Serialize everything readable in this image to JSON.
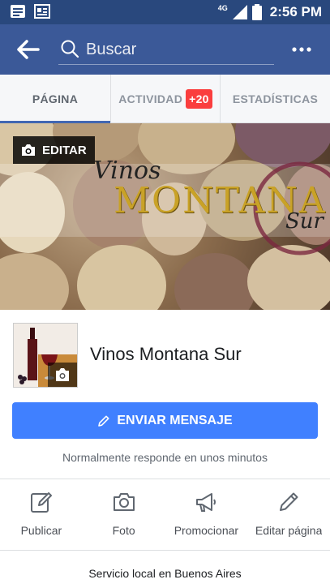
{
  "status_bar": {
    "network": "4G",
    "time": "2:56 PM"
  },
  "search": {
    "placeholder": "Buscar"
  },
  "tabs": [
    {
      "label": "PÁGINA",
      "active": true
    },
    {
      "label": "ACTIVIDAD",
      "badge": "+20"
    },
    {
      "label": "ESTADÍSTICAS"
    }
  ],
  "cover": {
    "edit_label": "EDITAR",
    "logo_line1": "Vinos",
    "logo_line2": "MONTANA",
    "logo_line3": "Sur"
  },
  "page": {
    "name": "Vinos Montana Sur",
    "send_message_label": "ENVIAR MENSAJE",
    "response_note": "Normalmente responde en unos minutos"
  },
  "actions": [
    {
      "label": "Publicar",
      "icon": "compose-icon"
    },
    {
      "label": "Foto",
      "icon": "camera-icon"
    },
    {
      "label": "Promocionar",
      "icon": "megaphone-icon"
    },
    {
      "label": "Editar página",
      "icon": "pencil-icon"
    }
  ],
  "footer": {
    "local_service": "Servicio local en Buenos Aires"
  },
  "colors": {
    "header": "#3b5998",
    "status_bar": "#29487d",
    "primary_button": "#4080ff",
    "badge": "#fa3e3e",
    "active_tab_indicator": "#4267b2"
  }
}
